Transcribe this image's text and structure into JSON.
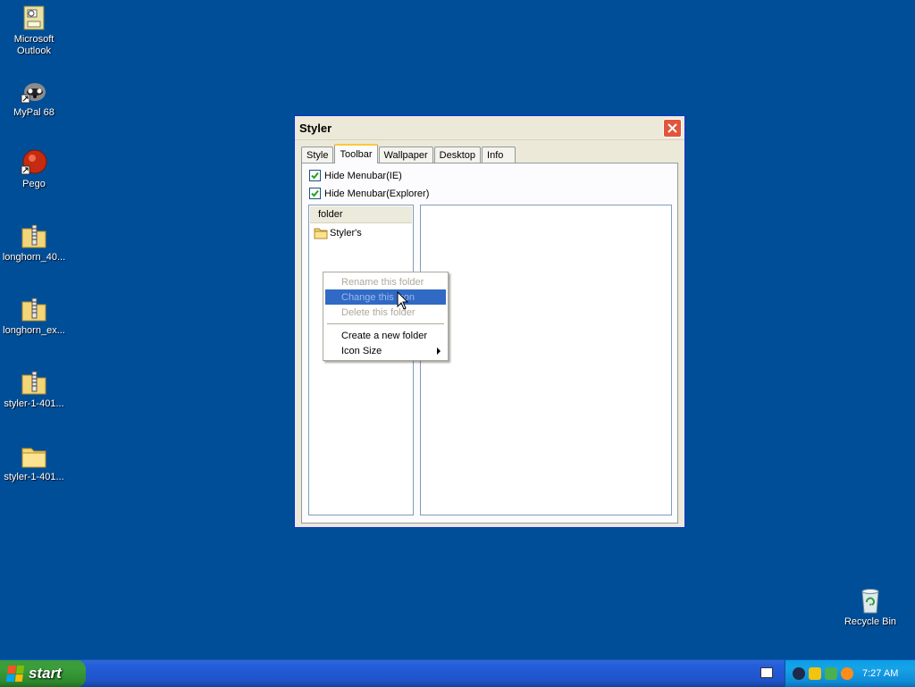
{
  "desktop": {
    "icons": [
      {
        "label": "Microsoft\nOutlook",
        "icon": "outlook-icon"
      },
      {
        "label": "MyPal 68",
        "icon": "mypal-icon"
      },
      {
        "label": "Pego",
        "icon": "pego-icon"
      },
      {
        "label": "longhorn_40...",
        "icon": "zip-folder-icon"
      },
      {
        "label": "longhorn_ex...",
        "icon": "zip-folder-icon"
      },
      {
        "label": "styler-1-401...",
        "icon": "zip-folder-icon"
      },
      {
        "label": "styler-1-401...",
        "icon": "folder-icon"
      },
      {
        "label": "Recycle Bin",
        "icon": "recycle-bin-icon"
      }
    ]
  },
  "window": {
    "title": "Styler",
    "tabs": [
      "Style",
      "Toolbar",
      "Wallpaper",
      "Desktop",
      "Info"
    ],
    "active_tab": "Toolbar",
    "checkboxes": [
      {
        "label": "Hide Menubar(IE)",
        "checked": true
      },
      {
        "label": "Hide Menubar(Explorer)",
        "checked": true
      }
    ],
    "tree": {
      "header": "folder",
      "items": [
        "Styler's"
      ]
    }
  },
  "context_menu": {
    "items": [
      {
        "label": "Rename this folder",
        "disabled": true
      },
      {
        "label": "Change this icon",
        "disabled": true,
        "highlighted": true
      },
      {
        "label": "Delete this folder",
        "disabled": true
      },
      {
        "label": "Create a new folder",
        "disabled": false
      },
      {
        "label": "Icon Size",
        "disabled": false,
        "submenu": true
      }
    ]
  },
  "taskbar": {
    "start_label": "start",
    "clock": "7:27 AM"
  },
  "colors": {
    "desktop_bg": "#004e98",
    "highlight": "#316ac5",
    "close_red": "#e2553b"
  }
}
